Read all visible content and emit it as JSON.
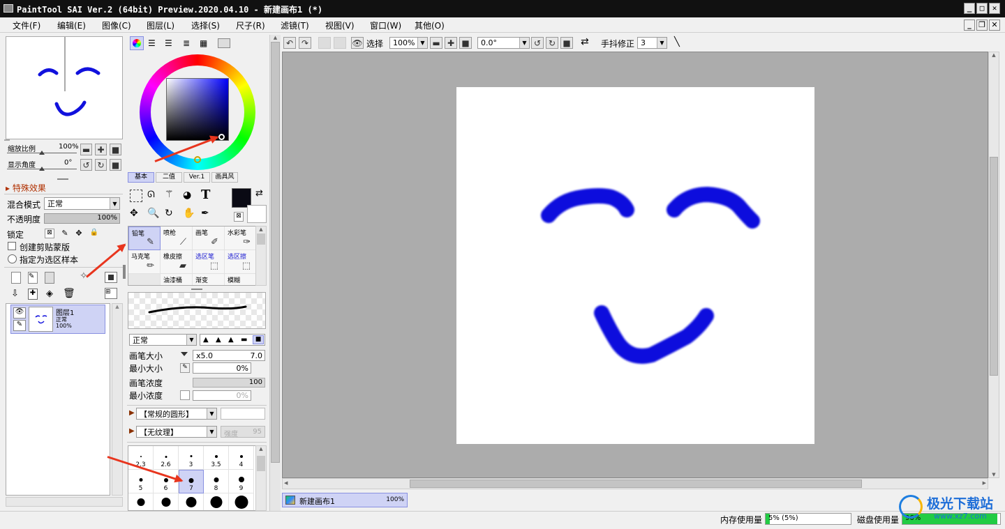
{
  "app": {
    "title": "PaintTool SAI Ver.2 (64bit) Preview.2020.04.10 - 新建画布1 (*)"
  },
  "window_controls": {
    "minimize": "_",
    "maximize": "□",
    "close": "✕"
  },
  "menu": [
    "文件(F)",
    "编辑(E)",
    "图像(C)",
    "图层(L)",
    "选择(S)",
    "尺子(R)",
    "滤镜(T)",
    "视图(V)",
    "窗口(W)",
    "其他(O)"
  ],
  "navigator": {
    "zoom_label": "缩放比例",
    "zoom_value": "100%",
    "angle_label": "显示角度",
    "angle_value": "0°"
  },
  "layer_panel": {
    "effects_label": "特殊效果",
    "blend_label": "混合模式",
    "blend_value": "正常",
    "opacity_label": "不透明度",
    "opacity_value": "100%",
    "lock_label": "锁定",
    "clip_label": "创建剪贴蒙版",
    "sample_label": "指定为选区样本",
    "layer": {
      "name": "图层1",
      "mode": "正常",
      "opacity": "100%"
    }
  },
  "color_tabs": [
    "基本",
    "二值",
    "Ver.1",
    "画具风"
  ],
  "tools": [
    {
      "label": "铅笔",
      "selected": true
    },
    {
      "label": "喷枪"
    },
    {
      "label": "画笔"
    },
    {
      "label": "水彩笔"
    },
    {
      "label": "马克笔"
    },
    {
      "label": "橡皮擦"
    },
    {
      "label": "选区笔",
      "blue": true
    },
    {
      "label": "选区擦",
      "blue": true
    },
    {
      "label": "",
      "blank": true
    },
    {
      "label": "油漆桶"
    },
    {
      "label": "渐变"
    },
    {
      "label": "模糊"
    }
  ],
  "brush": {
    "mode": "正常",
    "size_label": "画笔大小",
    "size_mult": "x5.0",
    "size_value": "7.0",
    "min_size_label": "最小大小",
    "min_size_value": "0%",
    "density_label": "画笔浓度",
    "density_value": "100",
    "min_density_label": "最小浓度",
    "min_density_value": "0%",
    "shape": "【常规的圆形】",
    "texture": "【无纹理】",
    "texture_strength_label": "强度",
    "texture_strength_value": "95"
  },
  "brush_sizes": [
    [
      "2.3",
      "2.6",
      "3",
      "3.5",
      "4"
    ],
    [
      "5",
      "6",
      "7",
      "8",
      "9"
    ],
    [
      "",
      "",
      "",
      "",
      ""
    ]
  ],
  "canvas_toolbar": {
    "select_label": "选择",
    "zoom": "100%",
    "angle": "0.0°",
    "stabilizer_label": "手抖修正",
    "stabilizer_value": "3"
  },
  "document_tab": {
    "name": "新建画布1",
    "zoom": "100%"
  },
  "status": {
    "memory_label": "内存使用量",
    "memory_value": "5% (5%)",
    "disk_label": "磁盘使用量",
    "disk_value": "96%"
  },
  "watermark": {
    "text": "极光下载站",
    "url": "www.xz7.com"
  },
  "colors": {
    "stroke": "#1111dd",
    "arrow": "#e8351e",
    "canvas_bg": "#acacac"
  }
}
